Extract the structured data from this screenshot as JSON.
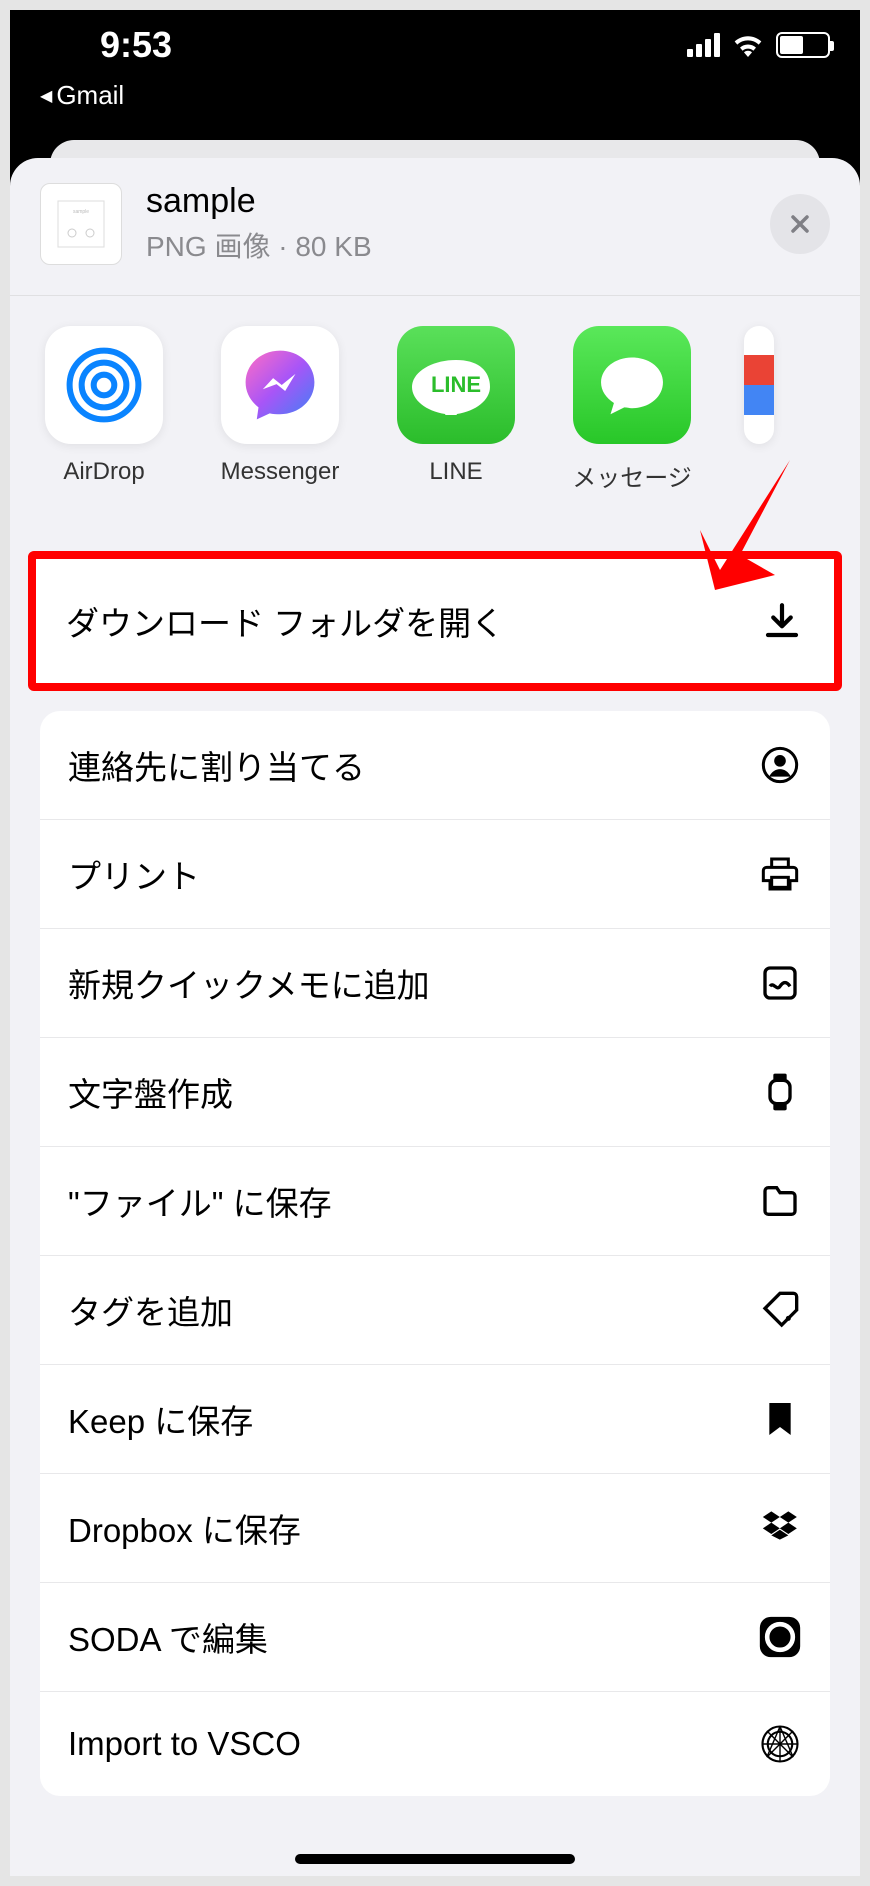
{
  "status": {
    "time": "9:53",
    "back_app": "Gmail"
  },
  "file": {
    "name": "sample",
    "meta": "PNG 画像 · 80 KB"
  },
  "apps": [
    {
      "label": "AirDrop",
      "icon": "airdrop"
    },
    {
      "label": "Messenger",
      "icon": "messenger"
    },
    {
      "label": "LINE",
      "icon": "line"
    },
    {
      "label": "メッセージ",
      "icon": "messages"
    }
  ],
  "highlighted_action": {
    "label": "ダウンロード フォルダを開く",
    "icon": "download"
  },
  "actions": [
    {
      "label": "連絡先に割り当てる",
      "icon": "contact"
    },
    {
      "label": "プリント",
      "icon": "print"
    },
    {
      "label": "新規クイックメモに追加",
      "icon": "quicknote"
    },
    {
      "label": "文字盤作成",
      "icon": "watchface"
    },
    {
      "label": "\"ファイル\" に保存",
      "icon": "folder"
    },
    {
      "label": "タグを追加",
      "icon": "tag"
    },
    {
      "label": "Keep に保存",
      "icon": "bookmark"
    },
    {
      "label": "Dropbox に保存",
      "icon": "dropbox"
    },
    {
      "label": "SODA で編集",
      "icon": "soda"
    },
    {
      "label": "Import to VSCO",
      "icon": "vsco"
    }
  ]
}
